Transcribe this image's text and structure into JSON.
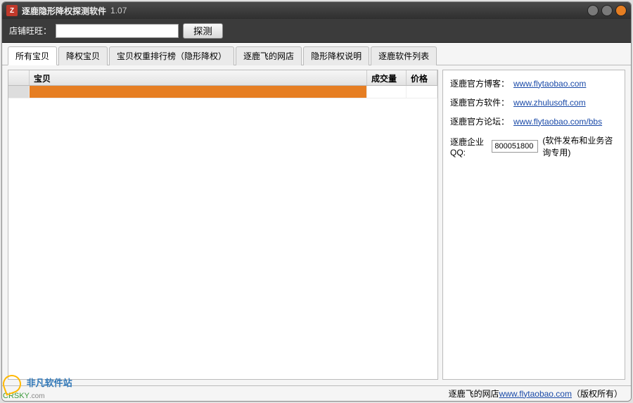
{
  "titlebar": {
    "icon_letter": "Z",
    "title": "逐鹿隐形降权探测软件",
    "version": "1.07"
  },
  "toolbar": {
    "shop_label": "店铺旺旺：",
    "shop_value": "",
    "detect_label": "探测"
  },
  "tabs": [
    "所有宝贝",
    "降权宝贝",
    "宝贝权重排行榜（隐形降权）",
    "逐鹿飞的网店",
    "隐形降权说明",
    "逐鹿软件列表"
  ],
  "grid": {
    "headers": {
      "name": "宝贝",
      "volume": "成交量",
      "price": "价格"
    },
    "rows": [
      {
        "name": "",
        "volume": "",
        "price": "",
        "highlight": true
      }
    ]
  },
  "info": {
    "blog_label": "逐鹿官方博客：",
    "blog_link": "www.flytaobao.com",
    "soft_label": "逐鹿官方软件：",
    "soft_link": "www.zhulusoft.com",
    "forum_label": "逐鹿官方论坛：",
    "forum_link": "www.flytaobao.com/bbs",
    "qq_label": "逐鹿企业QQ:",
    "qq_value": "800051800",
    "qq_note": "(软件发布和业务咨询专用)"
  },
  "footer": {
    "text_prefix": "逐鹿飞的网店",
    "link": "www.flytaobao.com",
    "text_suffix": "（版权所有）"
  },
  "watermark": {
    "zh": "非凡软件站",
    "en": "CRSKY",
    "suffix": ".com"
  }
}
